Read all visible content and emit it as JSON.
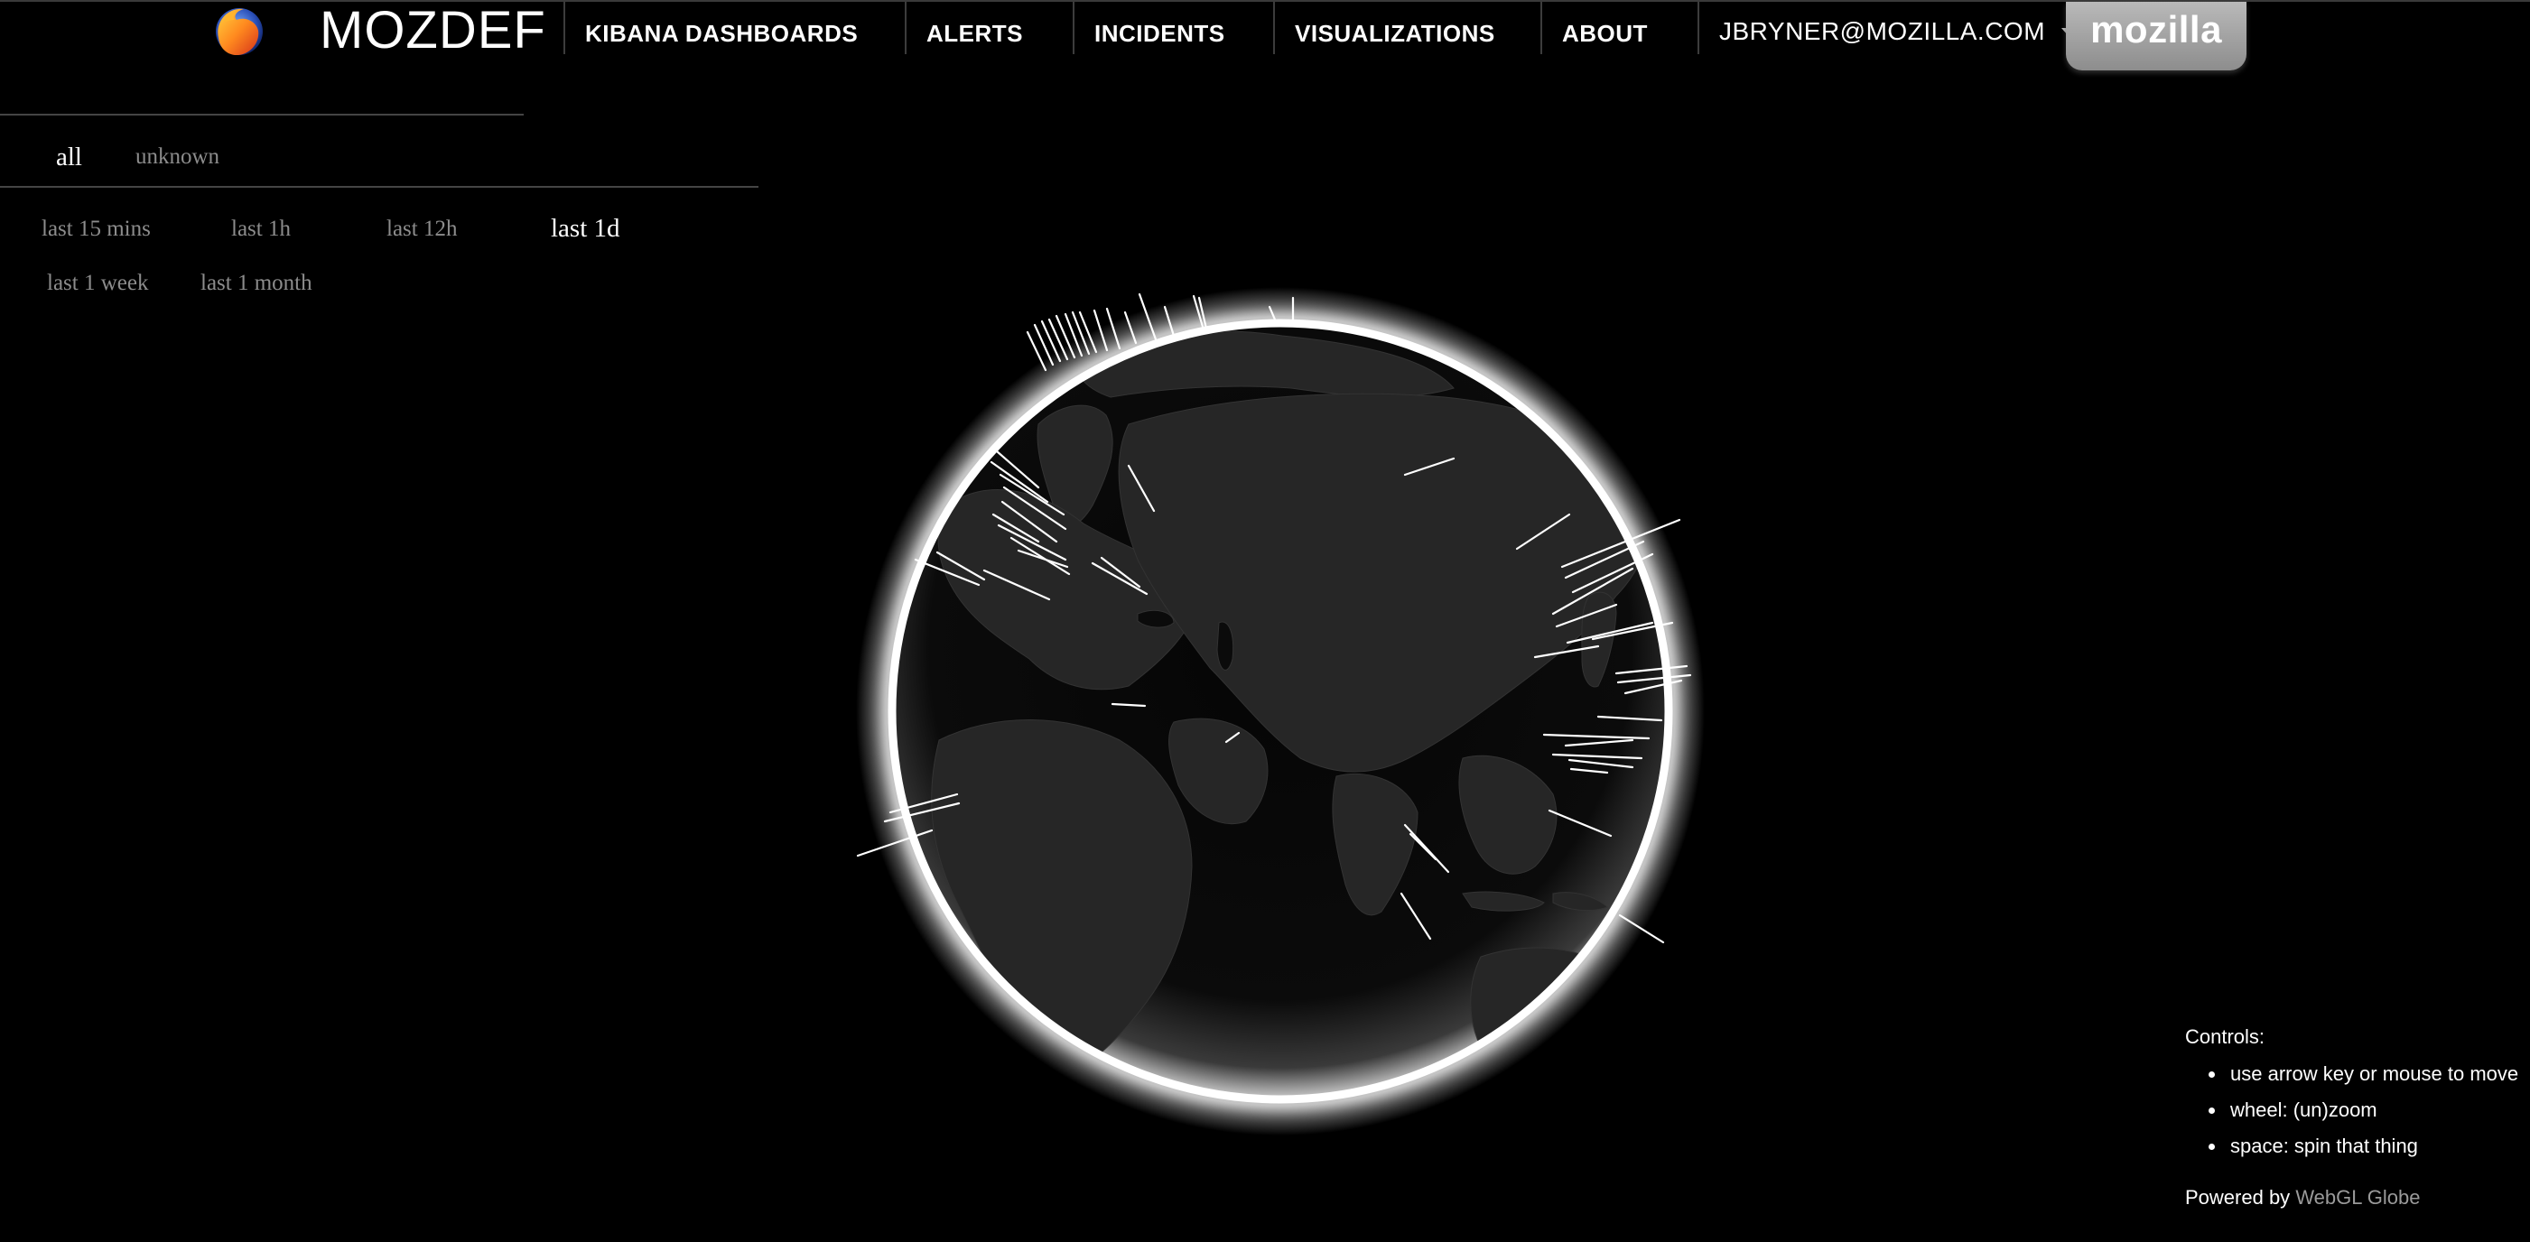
{
  "app": {
    "brand": "MOZDEF"
  },
  "nav": {
    "items": [
      {
        "label": "KIBANA DASHBOARDS"
      },
      {
        "label": "ALERTS"
      },
      {
        "label": "INCIDENTS"
      },
      {
        "label": "VISUALIZATIONS"
      },
      {
        "label": "ABOUT"
      }
    ],
    "user": "JBRYNER@MOZILLA.COM",
    "mozilla_tab": "mozilla"
  },
  "filters": {
    "categories": [
      {
        "label": "all",
        "active": true
      },
      {
        "label": "unknown",
        "active": false
      }
    ],
    "time_ranges": [
      {
        "label": "last 15 mins",
        "active": false
      },
      {
        "label": "last 1h",
        "active": false
      },
      {
        "label": "last 12h",
        "active": false
      },
      {
        "label": "last 1d",
        "active": true
      },
      {
        "label": "last 1 week",
        "active": false
      },
      {
        "label": "last 1 month",
        "active": false
      }
    ]
  },
  "controls": {
    "title": "Controls:",
    "items": [
      "use arrow key or mouse to move",
      "wheel: (un)zoom",
      "space: spin that thing"
    ],
    "powered_prefix": "Powered by",
    "powered_link": "WebGL Globe"
  },
  "colors": {
    "background": "#000000",
    "text": "#ffffff",
    "inactive_filter": "#8c8c8c",
    "globe_glow": "#ffffff",
    "spike": "#ffffff",
    "mozilla_tab": "#a3a3a3"
  },
  "icons": {
    "browser_logo": "firefox-logo-icon",
    "user_menu": "caret-down-icon"
  }
}
